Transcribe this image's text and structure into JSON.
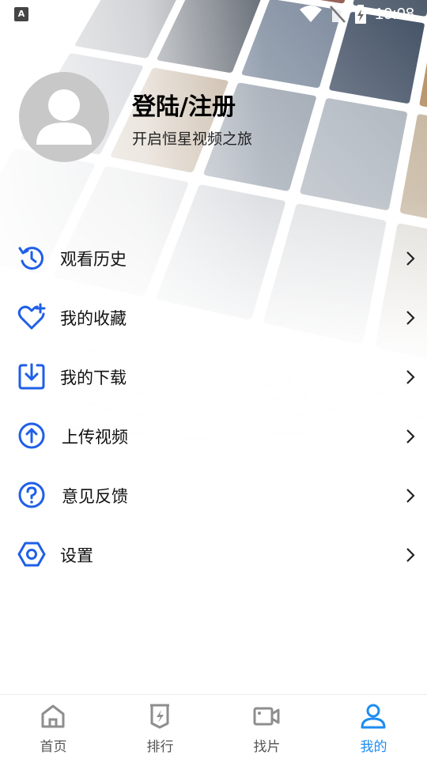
{
  "status_bar": {
    "time": "10:08",
    "app_icon_letter": "A",
    "icons": [
      "wifi-icon",
      "no-sim-icon",
      "battery-charging-icon"
    ]
  },
  "profile": {
    "title": "登陆/注册",
    "subtitle": "开启恒星视频之旅",
    "avatar_icon": "user-silhouette-icon"
  },
  "menu": {
    "accent_color": "#1f5fe8",
    "items": [
      {
        "label": "观看历史",
        "icon": "history-icon"
      },
      {
        "label": "我的收藏",
        "icon": "heart-plus-icon"
      },
      {
        "label": "我的下载",
        "icon": "download-icon"
      },
      {
        "label": "上传视频",
        "icon": "upload-icon"
      },
      {
        "label": "意见反馈",
        "icon": "feedback-question-icon"
      },
      {
        "label": "设置",
        "icon": "settings-hexagon-icon"
      }
    ]
  },
  "bottom_nav": {
    "active_color": "#1e8cf0",
    "items": [
      {
        "label": "首页",
        "icon": "home-icon",
        "active": false
      },
      {
        "label": "排行",
        "icon": "ranking-icon",
        "active": false
      },
      {
        "label": "找片",
        "icon": "video-camera-icon",
        "active": false
      },
      {
        "label": "我的",
        "icon": "profile-icon",
        "active": true
      }
    ]
  }
}
